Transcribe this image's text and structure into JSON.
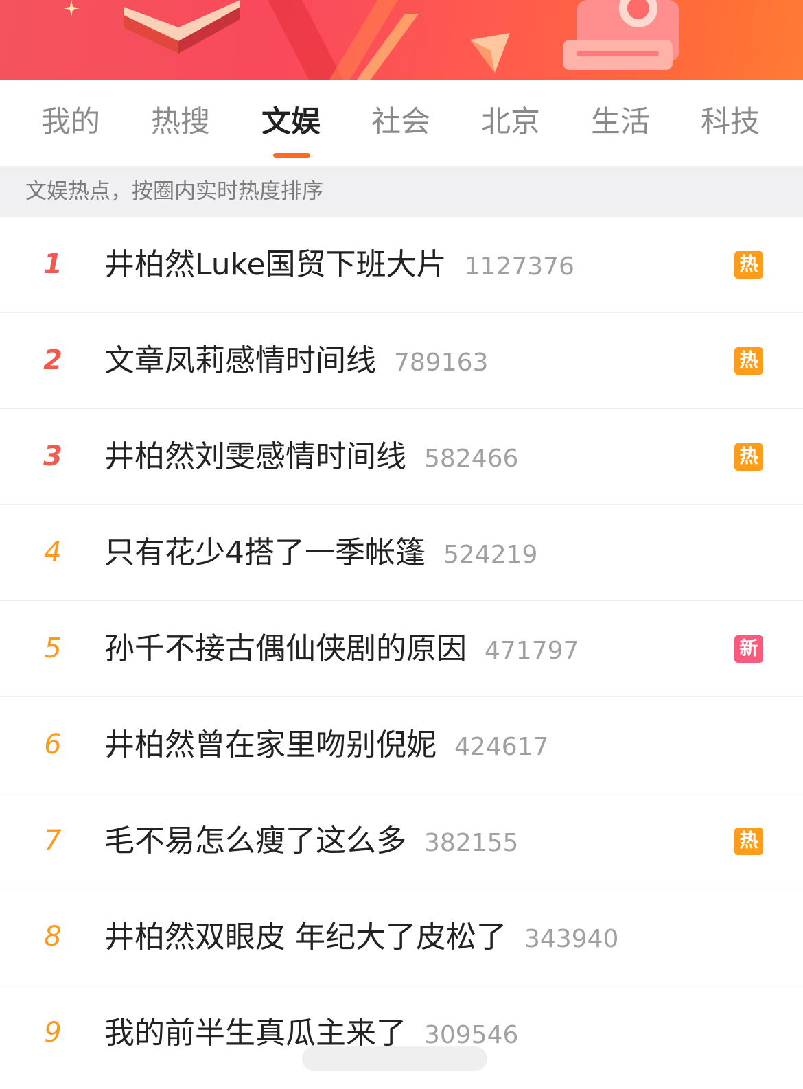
{
  "colors": {
    "banner_start": "#f4545d",
    "banner_end": "#ff7b33",
    "accent": "#ff6a1f",
    "rank_top": "#f25a4f",
    "rank_other": "#ff9a1f",
    "badge_hot": "#ff9c1a",
    "badge_new": "#fb5a7e"
  },
  "banner": {
    "icons": [
      "book-icon",
      "paper-plane-icon",
      "camera-icon",
      "sparkle-icon"
    ]
  },
  "tabs": [
    {
      "label": "我的",
      "active": false
    },
    {
      "label": "热搜",
      "active": false
    },
    {
      "label": "文娱",
      "active": true
    },
    {
      "label": "社会",
      "active": false
    },
    {
      "label": "北京",
      "active": false
    },
    {
      "label": "生活",
      "active": false
    },
    {
      "label": "科技",
      "active": false
    }
  ],
  "subheader": "文娱热点，按圈内实时热度排序",
  "list": [
    {
      "rank": "1",
      "title": "井柏然Luke国贸下班大片",
      "count": "1127376",
      "badge": "热",
      "badge_type": "hot"
    },
    {
      "rank": "2",
      "title": "文章凤莉感情时间线",
      "count": "789163",
      "badge": "热",
      "badge_type": "hot"
    },
    {
      "rank": "3",
      "title": "井柏然刘雯感情时间线",
      "count": "582466",
      "badge": "热",
      "badge_type": "hot"
    },
    {
      "rank": "4",
      "title": "只有花少4搭了一季帐篷",
      "count": "524219",
      "badge": "",
      "badge_type": ""
    },
    {
      "rank": "5",
      "title": "孙千不接古偶仙侠剧的原因",
      "count": "471797",
      "badge": "新",
      "badge_type": "new"
    },
    {
      "rank": "6",
      "title": "井柏然曾在家里吻别倪妮",
      "count": "424617",
      "badge": "",
      "badge_type": ""
    },
    {
      "rank": "7",
      "title": "毛不易怎么瘦了这么多",
      "count": "382155",
      "badge": "热",
      "badge_type": "hot"
    },
    {
      "rank": "8",
      "title": "井柏然双眼皮 年纪大了皮松了",
      "count": "343940",
      "badge": "",
      "badge_type": ""
    },
    {
      "rank": "9",
      "title": "我的前半生真瓜主来了",
      "count": "309546",
      "badge": "",
      "badge_type": ""
    }
  ]
}
